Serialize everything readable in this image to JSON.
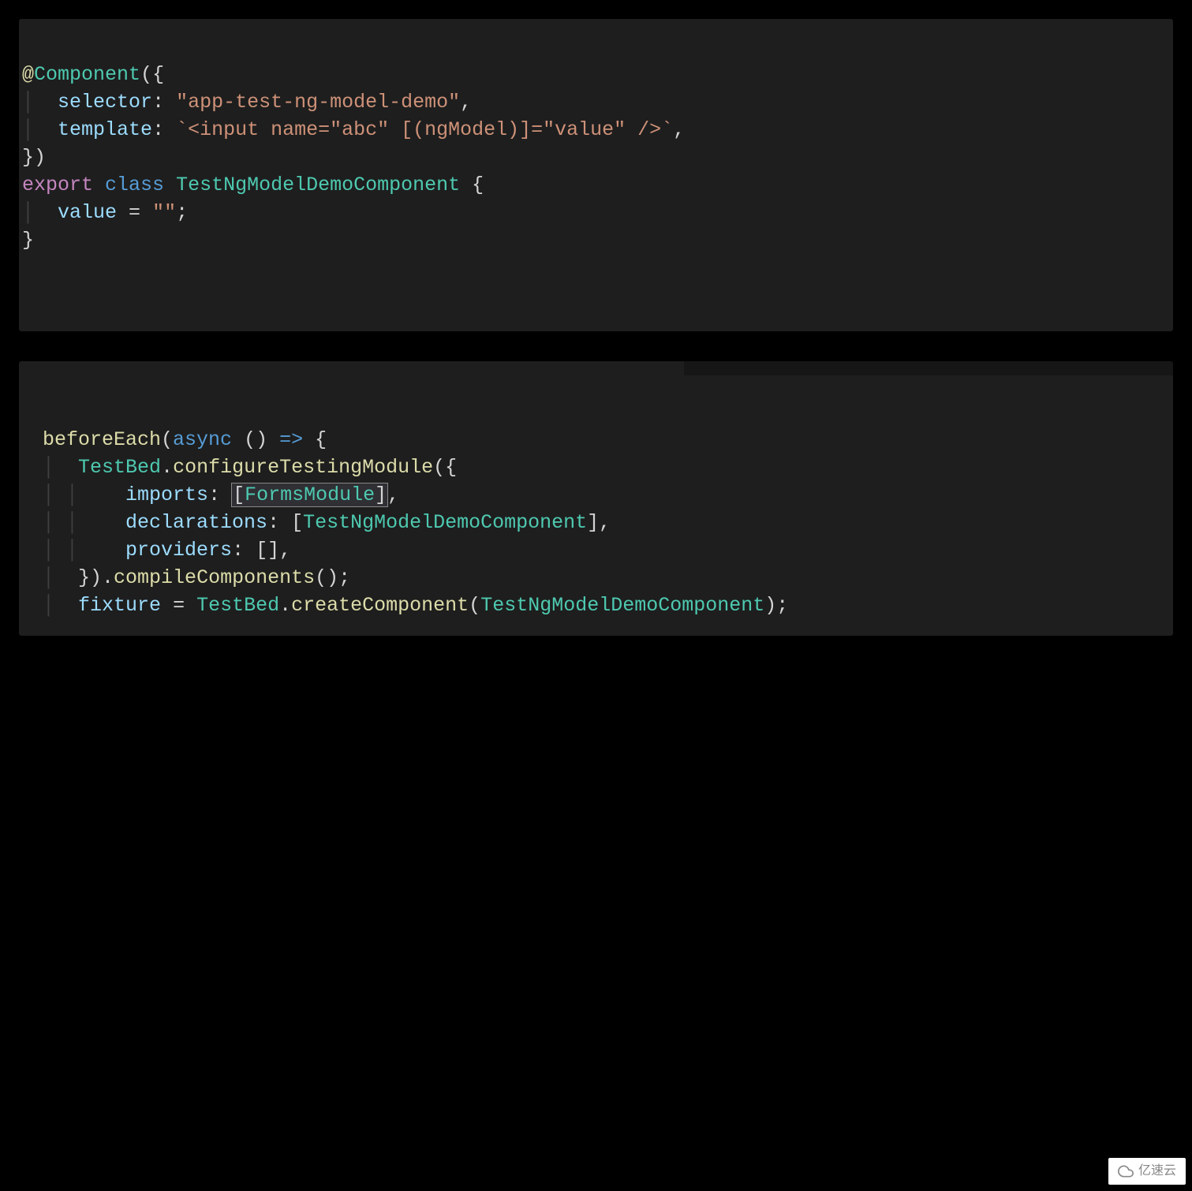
{
  "block1": {
    "l1_decor_at": "@",
    "l1_decor_name": "Component",
    "l1_paren_open": "(",
    "l1_brace_open": "{",
    "l2_indent": "  ",
    "l2_key": "selector",
    "l2_colon": ": ",
    "l2_val": "\"app-test-ng-model-demo\"",
    "l2_comma": ",",
    "l3_indent": "  ",
    "l3_key": "template",
    "l3_colon": ": ",
    "l3_val": "`<input name=\"abc\" [(ngModel)]=\"value\" />`",
    "l3_comma": ",",
    "l4_close": "})",
    "l5_export": "export",
    "l5_sp1": " ",
    "l5_class": "class",
    "l5_sp2": " ",
    "l5_name": "TestNgModelDemoComponent",
    "l5_sp3": " ",
    "l5_brace": "{",
    "l6_indent": "  ",
    "l6_var": "value",
    "l6_eq": " = ",
    "l6_val": "\"\"",
    "l6_semi": ";",
    "l7_close": "}"
  },
  "block2": {
    "l1_fn": "beforeEach",
    "l1_paren": "(",
    "l1_async": "async",
    "l1_sp": " ",
    "l1_parens2": "()",
    "l1_arrow": " => ",
    "l1_brace": "{",
    "l2_indent": "  ",
    "l2_cls": "TestBed",
    "l2_dot": ".",
    "l2_fn": "configureTestingModule",
    "l2_paren": "(",
    "l2_brace": "{",
    "l3_indent": "    ",
    "l3_key": "imports",
    "l3_colon": ": ",
    "l3_lb": "[",
    "l3_val": "FormsModule",
    "l3_rb": "]",
    "l3_comma": ",",
    "l4_indent": "    ",
    "l4_key": "declarations",
    "l4_colon": ": ",
    "l4_lb": "[",
    "l4_val": "TestNgModelDemoComponent",
    "l4_rb": "]",
    "l4_comma": ",",
    "l5_indent": "    ",
    "l5_key": "providers",
    "l5_colon": ": ",
    "l5_val": "[]",
    "l5_comma": ",",
    "l6_indent": "  ",
    "l6_close": "}).",
    "l6_fn": "compileComponents",
    "l6_parens": "();",
    "l7_indent": "  ",
    "l7_var": "fixture",
    "l7_eq": " = ",
    "l7_cls": "TestBed",
    "l7_dot": ".",
    "l7_fn": "createComponent",
    "l7_paren": "(",
    "l7_arg": "TestNgModelDemoComponent",
    "l7_close": ");"
  },
  "watermark_text": "亿速云"
}
